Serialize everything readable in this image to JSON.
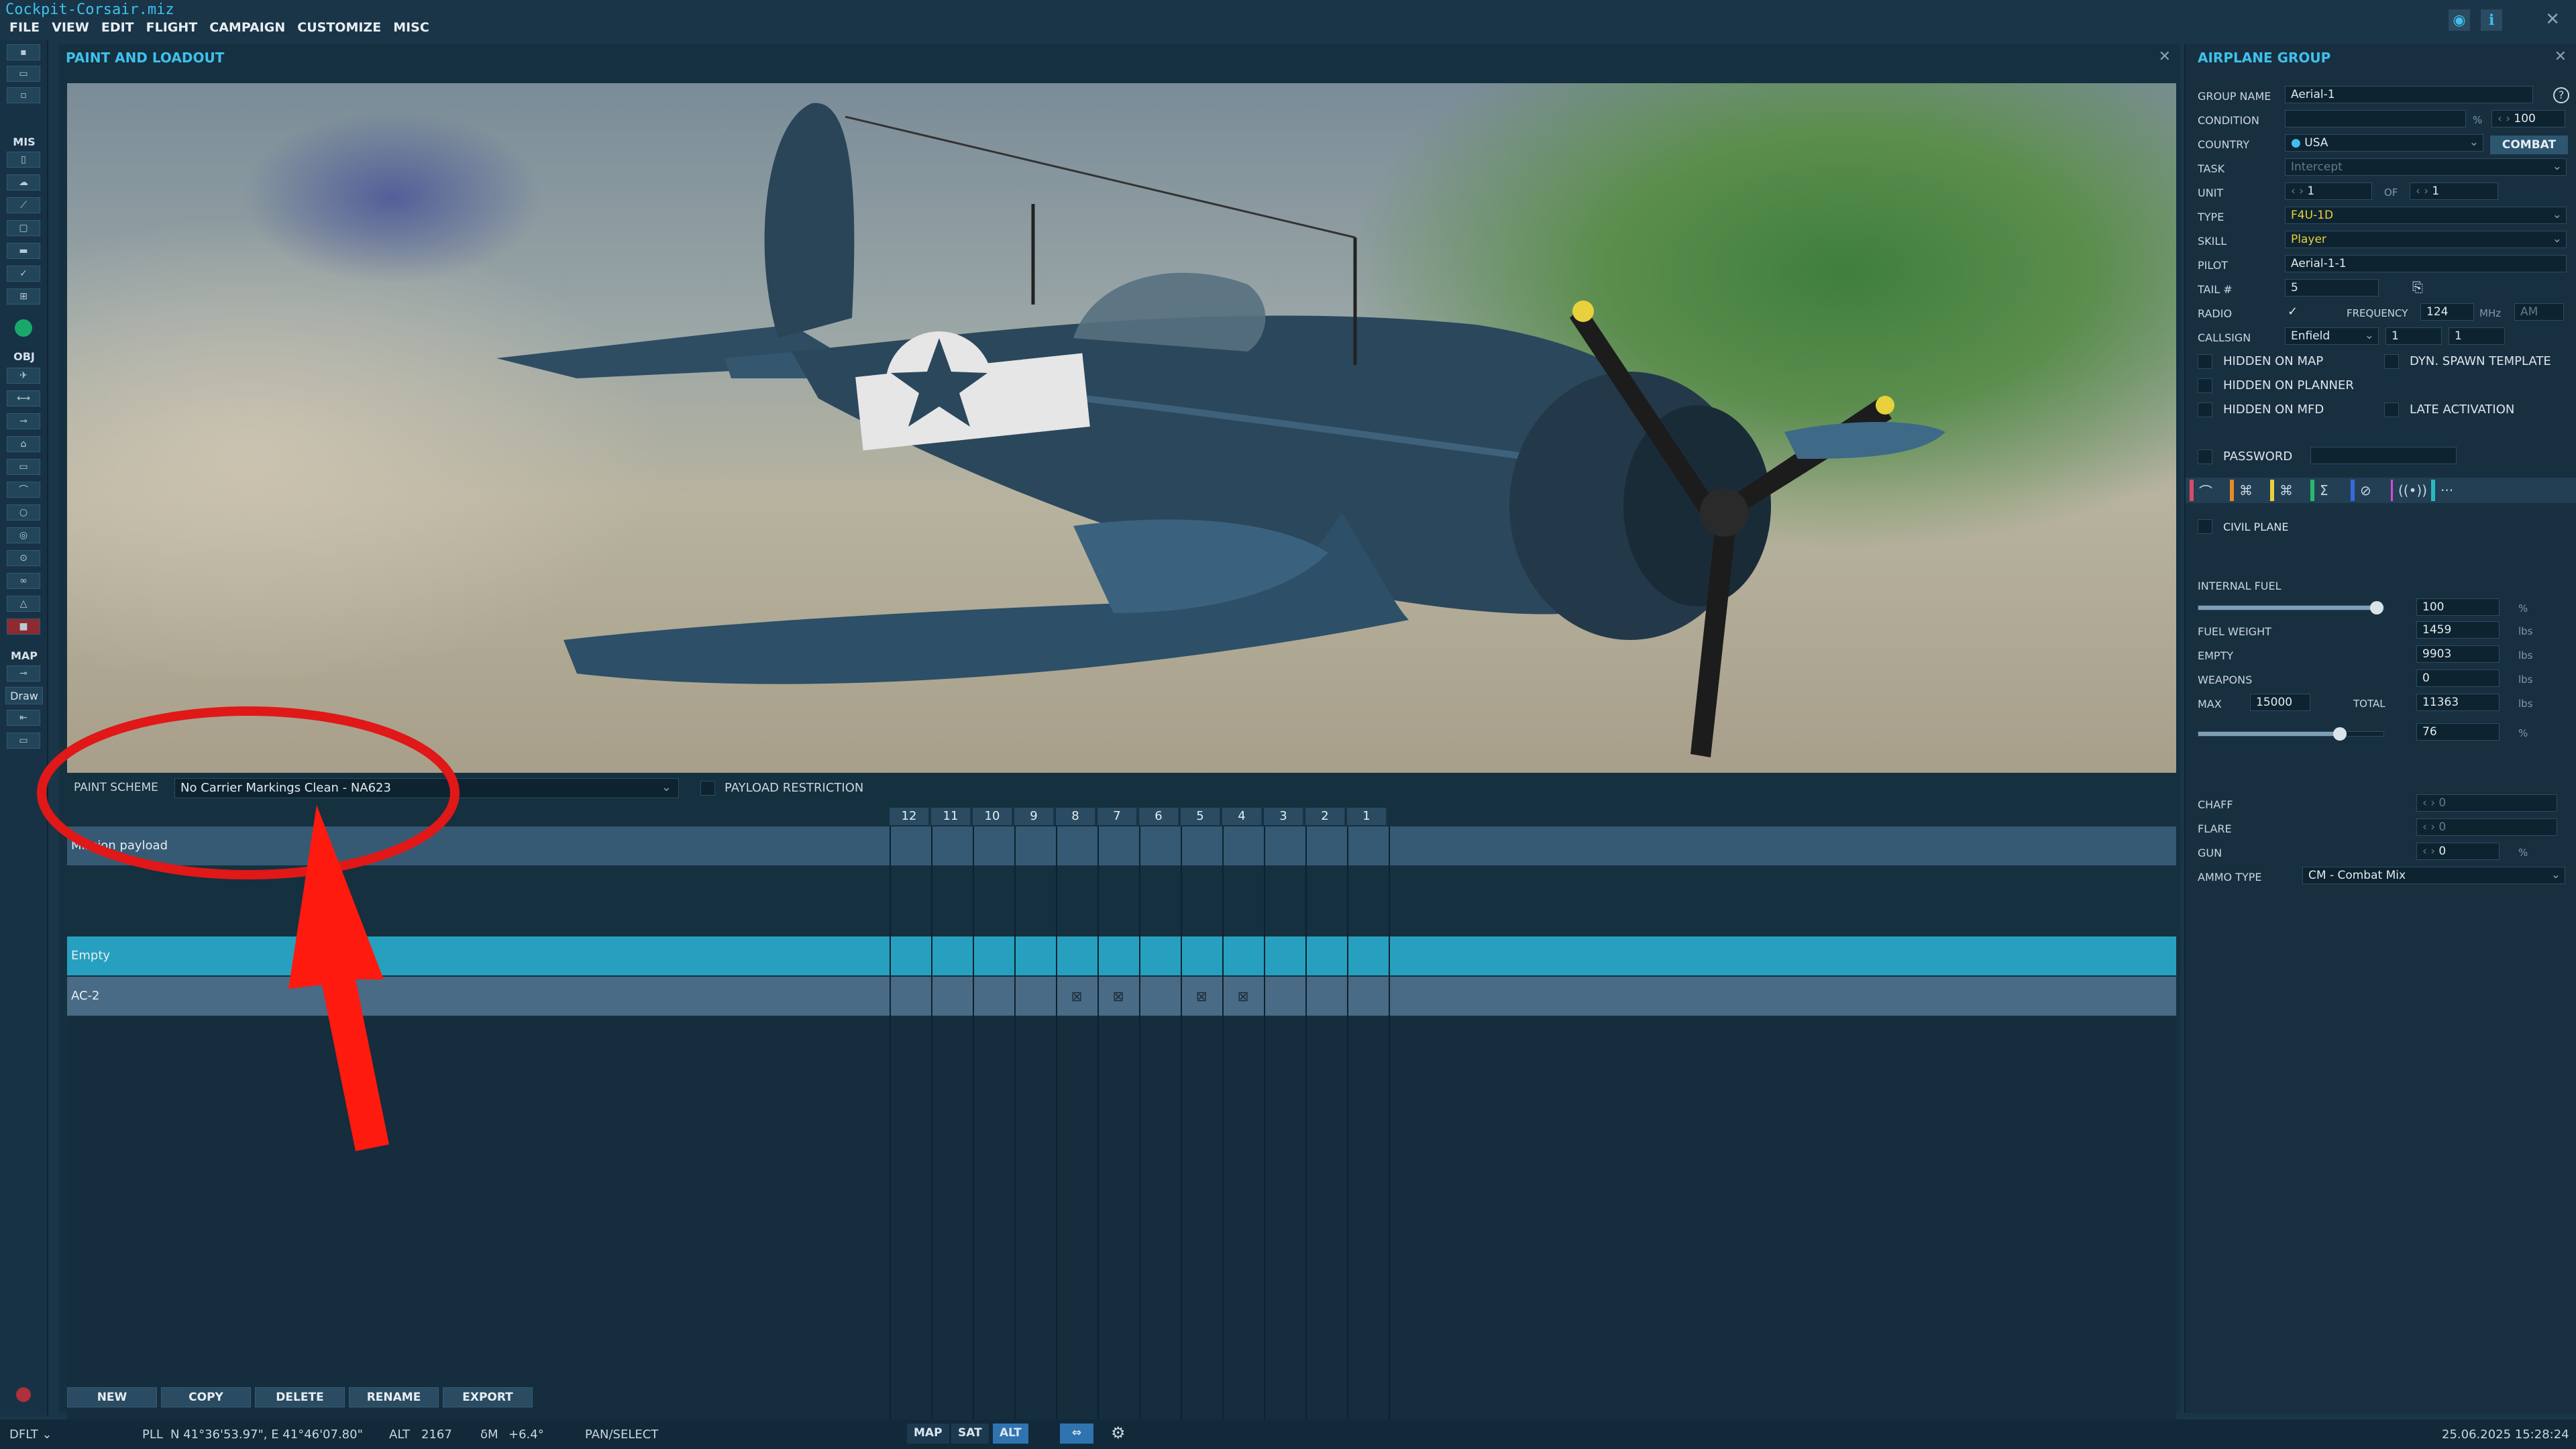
{
  "window": {
    "title": "Cockpit-Corsair.miz"
  },
  "menu": [
    "FILE",
    "VIEW",
    "EDIT",
    "FLIGHT",
    "CAMPAIGN",
    "CUSTOMIZE",
    "MISC"
  ],
  "left_toolbar": {
    "sections": [
      "MIS",
      "OBJ",
      "MAP"
    ],
    "draw_label": "Draw"
  },
  "main_panel": {
    "title": "PAINT AND LOADOUT",
    "paint_scheme_label": "PAINT SCHEME",
    "paint_scheme_value": "No Carrier Markings Clean - NA623",
    "payload_restriction_label": "PAYLOAD RESTRICTION",
    "pylons": [
      "12",
      "11",
      "10",
      "9",
      "8",
      "7",
      "6",
      "5",
      "4",
      "3",
      "2",
      "1"
    ],
    "rows": [
      {
        "label": "Mission payload",
        "weapons": []
      },
      {
        "label": "Empty",
        "weapons": []
      },
      {
        "label": "AC-2",
        "weapons": [
          "8",
          "7",
          "5",
          "4"
        ]
      }
    ],
    "buttons": [
      "NEW",
      "COPY",
      "DELETE",
      "RENAME",
      "EXPORT"
    ]
  },
  "right_panel": {
    "title": "AIRPLANE GROUP",
    "group_name_label": "GROUP NAME",
    "group_name": "Aerial-1",
    "condition_label": "CONDITION",
    "condition_value": "100",
    "condition_unit": "%",
    "country_label": "COUNTRY",
    "country": "USA",
    "combat_label": "COMBAT",
    "task_label": "TASK",
    "task": "Intercept",
    "unit_label": "UNIT",
    "unit_value": "1",
    "of_label": "OF",
    "of_value": "1",
    "type_label": "TYPE",
    "type": "F4U-1D",
    "skill_label": "SKILL",
    "skill": "Player",
    "pilot_label": "PILOT",
    "pilot": "Aerial-1-1",
    "tail_label": "TAIL #",
    "tail": "5",
    "radio_label": "RADIO",
    "frequency_label": "FREQUENCY",
    "frequency": "124",
    "frequency_unit": "MHz",
    "modulation": "AM",
    "callsign_label": "CALLSIGN",
    "callsign": "Enfield",
    "callsign_n1": "1",
    "callsign_n2": "1",
    "checkboxes": {
      "hidden_on_map": "HIDDEN ON MAP",
      "dyn_spawn": "DYN. SPAWN TEMPLATE",
      "hidden_on_planner": "HIDDEN ON PLANNER",
      "hidden_on_mfd": "HIDDEN ON MFD",
      "late_activation": "LATE ACTIVATION",
      "password": "PASSWORD",
      "civil_plane": "CIVIL PLANE"
    },
    "tab_colors": [
      "#d94a6a",
      "#e88a2a",
      "#e8d13c",
      "#2ab86a",
      "#3a6ad9",
      "#d94ad0",
      "#2ab8c0"
    ],
    "fuel": {
      "internal_fuel_label": "INTERNAL FUEL",
      "internal_fuel": "100",
      "internal_fuel_level": 1.0,
      "fuel_weight_label": "FUEL WEIGHT",
      "fuel_weight": "1459",
      "empty_label": "EMPTY",
      "empty": "9903",
      "weapons_label": "WEAPONS",
      "weapons": "0",
      "max_label": "MAX",
      "max": "15000",
      "total_label": "TOTAL",
      "total": "11363",
      "total_percent": "76",
      "total_level": 0.76,
      "unit": "lbs",
      "percent": "%"
    },
    "chaff_label": "CHAFF",
    "chaff": "0",
    "flare_label": "FLARE",
    "flare": "0",
    "gun_label": "GUN",
    "gun": "0",
    "ammo_type_label": "AMMO TYPE",
    "ammo_type": "CM - Combat Mix"
  },
  "status_bar": {
    "profile": "DFLT",
    "coord_mode": "PLL",
    "coords": "N 41°36'53.97\", E 41°46'07.80\"",
    "alt_label": "ALT",
    "alt": "2167",
    "dm_label": "δM",
    "dm": "+6.4°",
    "mode": "PAN/SELECT",
    "map_tabs": [
      "MAP",
      "SAT",
      "ALT"
    ],
    "active_tab": "ALT",
    "datetime": "25.06.2025 15:28:24"
  }
}
